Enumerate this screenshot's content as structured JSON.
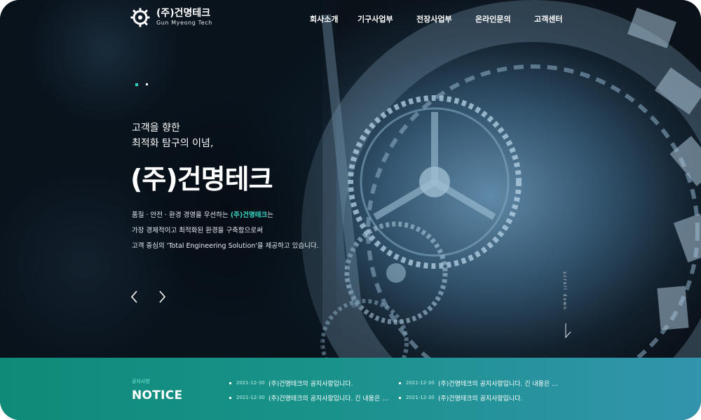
{
  "brand": {
    "name": "(주)건명테크",
    "subtitle": "Gun Myeong Tech"
  },
  "nav": [
    "회사소개",
    "기구사업부",
    "전장사업부",
    "온라인문의",
    "고객센터"
  ],
  "hero": {
    "tagline_line1": "고객을 향한",
    "tagline_line2": "최적화 탐구의 이념,",
    "title": "(주)건명테크",
    "desc_line1_pre": "품질 · 안전 · 환경 경영을 우선하는 ",
    "desc_line1_highlight": "(주)건명테크",
    "desc_line1_post": "는",
    "desc_line2": "가장 경제적이고 최적화된 환경을 구축함으로써",
    "desc_line3": "고객 중심의 'Total Engineering Solution'을 제공하고 있습니다.",
    "scroll_label": "scroll down",
    "slide_active_color": "#2bd6c6"
  },
  "notice": {
    "kicker": "공지사항",
    "title": "NOTICE",
    "items": [
      {
        "date": "2021-12-30",
        "text": "(주)건명테크의 공지사항입니다."
      },
      {
        "date": "2021-12-30",
        "text": "(주)건명테크의 공지사항입니다. 긴 내용은 …"
      },
      {
        "date": "2021-12-30",
        "text": "(주)건명테크의 공지사항입니다. 긴 내용은 …"
      },
      {
        "date": "2021-12-30",
        "text": "(주)건명테크의 공지사항입니다."
      }
    ]
  },
  "icons": {
    "logo": "gear-logo-icon",
    "prev": "chevron-left-icon",
    "next": "chevron-right-icon",
    "scroll": "scroll-down-arrow-icon"
  }
}
